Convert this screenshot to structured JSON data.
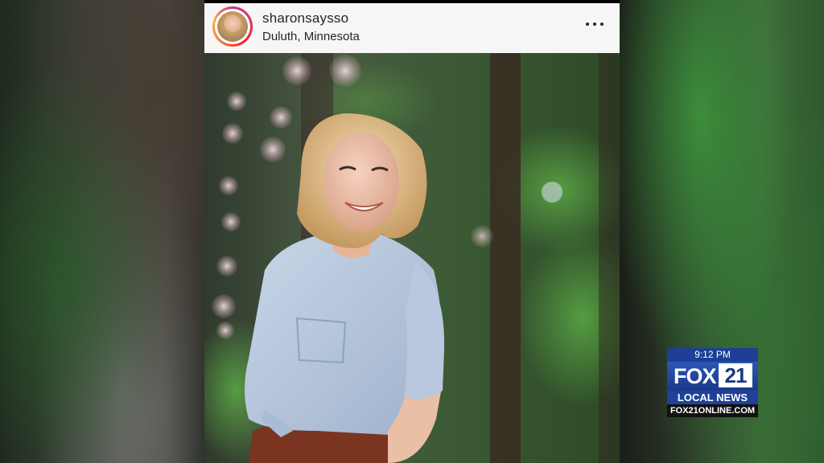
{
  "post": {
    "username": "sharonsaysso",
    "location": "Duluth, Minnesota",
    "more_icon": "more-horizontal-icon"
  },
  "news_bug": {
    "time": "9:12 PM",
    "brand_word": "FOX",
    "brand_number": "21",
    "tagline": "LOCAL NEWS",
    "website": "FOX21ONLINE.COM",
    "colors": {
      "primary": "#1d3f95",
      "text": "#ffffff"
    }
  }
}
